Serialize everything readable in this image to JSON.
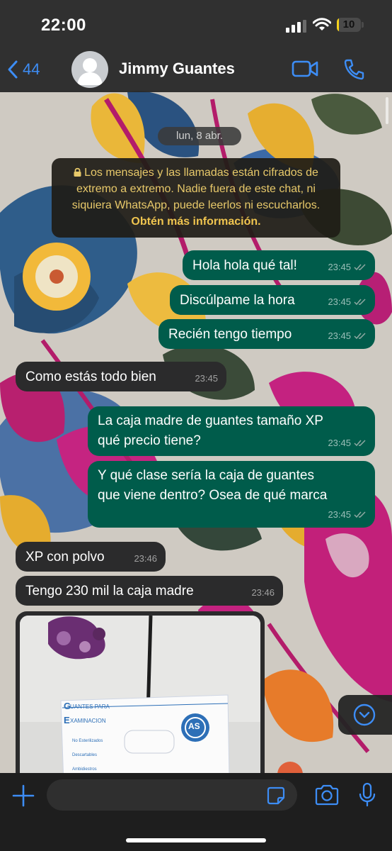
{
  "status_bar": {
    "time": "22:00",
    "battery_level": "10",
    "battery_fraction": 0.1
  },
  "header": {
    "back_count": "44",
    "contact_name": "Jimmy Guantes"
  },
  "chat": {
    "date_chip": "lun, 8 abr.",
    "notice": {
      "text": "Los mensajes y las llamadas están cifrados de extremo a extremo. Nadie fuera de este chat, ni siquiera WhatsApp, puede leerlos ni escucharlos.",
      "link": "Obtén más información."
    },
    "messages": [
      {
        "direction": "out",
        "lines": [
          "Hola hola qué tal!"
        ],
        "time": "23:45",
        "status": "read"
      },
      {
        "direction": "out",
        "lines": [
          "Discúlpame la hora"
        ],
        "time": "23:45",
        "status": "read"
      },
      {
        "direction": "out",
        "lines": [
          "Recién tengo tiempo"
        ],
        "time": "23:45",
        "status": "read"
      },
      {
        "direction": "in",
        "lines": [
          "Como estás todo bien"
        ],
        "time": "23:45"
      },
      {
        "direction": "out",
        "lines": [
          "La caja madre de guantes tamaño XP",
          "qué precio tiene?"
        ],
        "time": "23:45",
        "status": "read"
      },
      {
        "direction": "out",
        "lines": [
          "Y qué clase sería la caja de guantes",
          "que viene dentro? Osea de qué marca"
        ],
        "time": "23:45",
        "status": "read"
      },
      {
        "direction": "in",
        "lines": [
          "XP con polvo"
        ],
        "time": "23:46"
      },
      {
        "direction": "in",
        "lines": [
          "Tengo 230 mil la caja madre"
        ],
        "time": "23:46"
      }
    ],
    "image_box_text": {
      "brand_line1": "UANTES PARA",
      "brand_line2": "XAMINACION",
      "brand_initial1": "G",
      "brand_initial2": "E",
      "features": [
        "No Esterilizados",
        "Descartables",
        "Ambidiestros"
      ],
      "logo": "AS"
    }
  },
  "composer": {
    "placeholder": ""
  },
  "icons": {
    "back": "chevron-left-icon",
    "video": "video-camera-icon",
    "phone": "phone-icon",
    "add": "plus-icon",
    "sticker": "sticker-icon",
    "camera": "camera-icon",
    "mic": "microphone-icon",
    "scroll": "chevron-down-icon"
  },
  "colors": {
    "outgoing_bubble": "#005c4b",
    "incoming_bubble": "#2b2b2c",
    "accent_blue": "#3d8df5",
    "notice_text": "#e8c96a",
    "read_ticks": "#8fa9a3"
  }
}
